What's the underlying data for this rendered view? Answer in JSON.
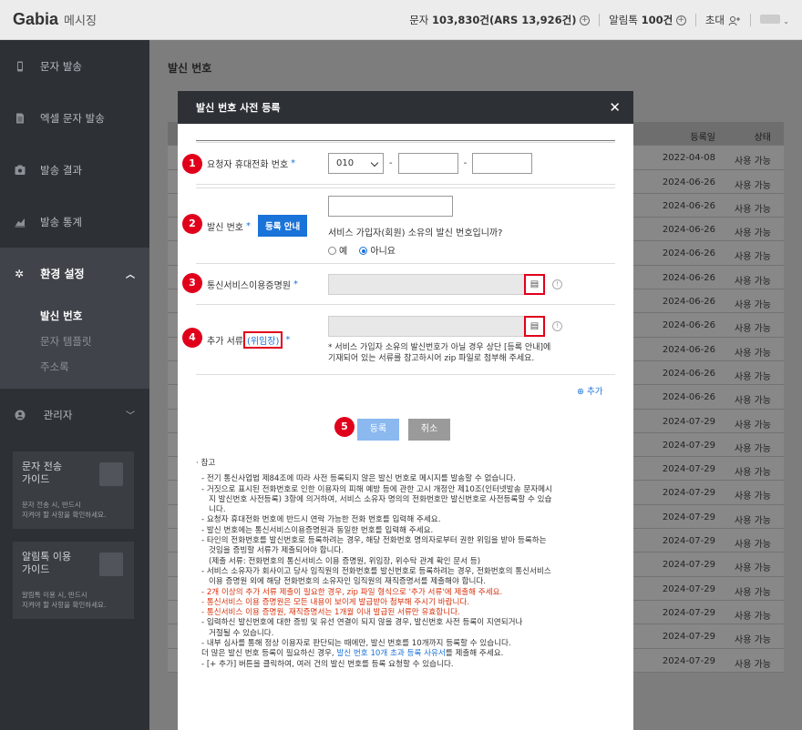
{
  "header": {
    "logo": "Gabia",
    "logo_sub": "메시징",
    "sms_label": "문자",
    "sms_count": "103,830건(ARS 13,926건)",
    "alimtalk_label": "알림톡",
    "alimtalk_count": "100건",
    "invite_label": "초대"
  },
  "sidebar": {
    "items": [
      {
        "label": "문자 발송",
        "icon": "phone-icon"
      },
      {
        "label": "엑셀 문자 발송",
        "icon": "document-icon"
      },
      {
        "label": "발송 결과",
        "icon": "result-icon"
      },
      {
        "label": "발송 통계",
        "icon": "chart-icon"
      }
    ],
    "active": {
      "label": "환경 설정",
      "icon": "gear-icon"
    },
    "subitems": [
      "발신 번호",
      "문자 템플릿",
      "주소록"
    ],
    "admin": {
      "label": "관리자",
      "icon": "person-icon"
    },
    "guides": [
      {
        "title": "문자 전송\n가이드",
        "desc": "문자 전송 시, 반드시\n지켜야 할 사항을 확인하세요."
      },
      {
        "title": "알림톡 이용\n가이드",
        "desc": "알림톡 이용 시, 반드시\n지켜야 할 사항을 확인하세요."
      }
    ]
  },
  "main": {
    "title": "발신 번호",
    "table_headers": {
      "date": "등록일",
      "status": "상태"
    },
    "rows": [
      {
        "date": "2022-04-08",
        "status": "사용 가능"
      },
      {
        "date": "2024-06-26",
        "status": "사용 가능"
      },
      {
        "date": "2024-06-26",
        "status": "사용 가능"
      },
      {
        "date": "2024-06-26",
        "status": "사용 가능"
      },
      {
        "date": "2024-06-26",
        "status": "사용 가능"
      },
      {
        "date": "2024-06-26",
        "status": "사용 가능"
      },
      {
        "date": "2024-06-26",
        "status": "사용 가능"
      },
      {
        "date": "2024-06-26",
        "status": "사용 가능"
      },
      {
        "date": "2024-06-26",
        "status": "사용 가능"
      },
      {
        "date": "2024-06-26",
        "status": "사용 가능"
      },
      {
        "date": "2024-06-26",
        "status": "사용 가능"
      },
      {
        "date": "2024-07-29",
        "status": "사용 가능"
      },
      {
        "date": "2024-07-29",
        "status": "사용 가능"
      },
      {
        "date": "2024-07-29",
        "status": "사용 가능"
      },
      {
        "date": "2024-07-29",
        "status": "사용 가능"
      },
      {
        "date": "2024-07-29",
        "status": "사용 가능"
      },
      {
        "date": "2024-07-29",
        "status": "사용 가능"
      },
      {
        "date": "2024-07-29",
        "status": "사용 가능"
      },
      {
        "date": "2024-07-29",
        "status": "사용 가능"
      },
      {
        "date": "2024-07-29",
        "status": "사용 가능"
      },
      {
        "date": "2024-07-29",
        "status": "사용 가능"
      },
      {
        "date": "2024-07-29",
        "status": "사용 가능"
      }
    ]
  },
  "modal": {
    "title": "발신 번호 사전 등록",
    "fields": {
      "phone_label": "요청자 휴대전화 번호",
      "phone_prefix": "010",
      "sender_label": "발신 번호",
      "sender_guide_button": "등록 안내",
      "member_question": "서비스 가입자(회원) 소유의 발신 번호입니까?",
      "radio_yes": "예",
      "radio_no": "아니요",
      "cert_label": "통신서비스이용증명원",
      "extra_label_prefix": "추가 서류",
      "extra_label_link": "(위임장)",
      "extra_note": "* 서비스 가입자 소유의 발신번호가 아닐 경우 상단 [등록 안내]에\n  기재되어 있는 서류를 참고하시어 zip 파일로 첨부해 주세요.",
      "add_link": "추가",
      "required_mark": "*"
    },
    "markers": [
      "1",
      "2",
      "3",
      "4",
      "5"
    ],
    "register_button": "등록",
    "cancel_button": "취소",
    "notes_head": "· 참고",
    "notes": [
      {
        "text": "- 전기 통신사업법 제84조에 따라 사전 등록되지 않은 발신 번호로 메시지를 발송할 수 없습니다.",
        "style": "normal"
      },
      {
        "text": "- 거짓으로 표시된 전화번호로 인한 이용자의 피해 예방 등에 관한 고시 개정안 제10조(인터넷발송 문자메시\n  지 발신번호 사전등록) 3항에 의거하여, 서비스 소유자 명의의 전화번호만 발신번호로 사전등록할 수 있습\n  니다.",
        "style": "normal"
      },
      {
        "text": "- 요청자 휴대전화 번호에 반드시 연락 가능한 전화 번호를 입력해 주세요.",
        "style": "normal"
      },
      {
        "text": "- 발신 번호에는 통신서비스이용증명원과 동일한 번호를 입력해 주세요.",
        "style": "normal"
      },
      {
        "text": "- 타인의 전화번호를 발신번호로 등록하려는 경우, 해당 전화번호 명의자로부터 권한 위임을 받아 등록하는\n  것임을 증빙할 서류가 제출되어야 합니다.\n  (제출 서류: 전화번호의 통신서비스 이용 증명원, 위임장, 위수탁 관계 확인 문서 등)",
        "style": "normal"
      },
      {
        "text": "- 서비스 소유자가 회사이고 당사 임직원의 전화번호를 발신번호로 등록하려는 경우, 전화번호의 통신서비스\n  이용 증명원 외에 해당 전화번호의 소유자인 임직원의 재직증명서를 제출해야 합니다.",
        "style": "normal"
      },
      {
        "text": "- 2개 이상의 추가 서류 제출이 필요한 경우, zip 파일 형식으로 '추가 서류'에 제출해 주세요.",
        "style": "red"
      },
      {
        "text": "- 통신서비스 이용 증명원은 모든 내용이 보이게 발급받아 첨부해 주시기 바랍니다.",
        "style": "red"
      },
      {
        "text": "- 통신서비스 이용 증명원, 재직증명서는 1개월 이내 발급된 서류만 유효합니다.",
        "style": "red"
      },
      {
        "text": "- 입력하신 발신번호에 대한 증빙 및 유선 연결이 되지 않을 경우, 발신번호 사전 등록이 지연되거나\n  거절될 수 있습니다.",
        "style": "normal"
      },
      {
        "text": "- 내부 심사를 통해 정상 이용자로 판단되는 때에만, 발신 번호를 10개까지 등록할 수 있습니다.",
        "style": "normal"
      },
      {
        "text": "  더 많은 발신 번호 등록이 필요하신 경우,",
        "style": "normal",
        "link": "발신 번호 10개 초과 등록 사유서",
        "tail": "를 제출해 주세요."
      },
      {
        "text": "- [+ 추가] 버튼을 클릭하여, 여러 건의 발신 번호를 등록 요청할 수 있습니다.",
        "style": "normal"
      }
    ]
  },
  "colors": {
    "accent": "#1a73d9",
    "marker": "#e0001b",
    "sidebar_bg": "#2d3035",
    "warning_text": "#d9320e"
  }
}
